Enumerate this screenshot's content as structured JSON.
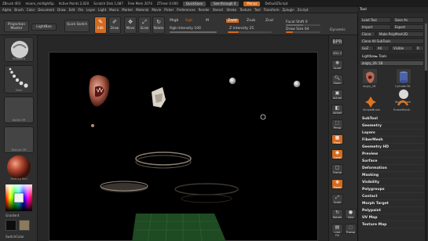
{
  "titlebar": {
    "app": "ZBrush 4R3",
    "file": "moore_midlightSp",
    "active_points": "Active Points 2,020",
    "scratch_disk": "Scratch Disk 1,687",
    "free_mem": "Free Mem 2074",
    "ztimer": "ZTimer 0.000",
    "quicksave": "QuickSave",
    "seethrough": "See-through 0",
    "menus_btn": "Menus",
    "default_script": "DefaultZScript"
  },
  "menubar": [
    "Alpha",
    "Brush",
    "Color",
    "Document",
    "Draw",
    "Edit",
    "File",
    "Layer",
    "Light",
    "Macro",
    "Marker",
    "Material",
    "Movie",
    "Picker",
    "Preferences",
    "Render",
    "Stencil",
    "Stroke",
    "Texture",
    "Tool",
    "Transform",
    "Zplugin",
    "Zscript"
  ],
  "toolbar": {
    "projection_master": "Projection Master",
    "lightbox": "LightBox",
    "quick_sketch": "Quick Sketch",
    "edit": "Edit",
    "draw": "Draw",
    "move": "Move",
    "scale": "Scale",
    "rotate": "Rotate",
    "mrgb": "Mrgb",
    "rgb": "Rgb",
    "m": "M",
    "rgb_intensity": "Rgb Intensity 100",
    "zadd": "Zadd",
    "zsub": "Zsub",
    "zcut": "Zcut",
    "z_intensity": "Z Intensity 25",
    "focal_shift": "Focal Shift 0",
    "draw_size": "Draw Size 64",
    "dynamic": "Dynamic"
  },
  "leftpanel": {
    "brush_label": "Standard",
    "stroke_label": "Dots",
    "alpha_label": "Alpha Off",
    "texture_label": "Texture Off",
    "material_label": "MatCap Red",
    "gradient_label": "Gradient",
    "switch_color_label": "SwitchColor"
  },
  "rightshelf": [
    "BPR",
    "SPix 3",
    "Scroll",
    "Zoom",
    "Actual",
    "AAHalf",
    "Persp",
    "Floor",
    "Local",
    "Frame",
    "Move",
    "Scale",
    "Rotate",
    "Line Fill",
    "Transp",
    "Solo"
  ],
  "tray": {
    "title": "Tool",
    "load_tool": "Load Tool",
    "save_as": "Save As",
    "import": "Import",
    "export": "Export",
    "clone": "Clone",
    "make_polymesh": "Make PolyMesh3D",
    "goz": "GoZ",
    "all": "All",
    "visible": "Visible",
    "r": "R",
    "clone_all_subtools": "Clone All SubTools",
    "lightbox_tools": "Lightbox► Tools",
    "current_tool": "angry_26. 58",
    "tool_names": [
      "angry_26",
      "Cylinder3D",
      "AlphaBrush",
      "SimpleBrush",
      "EraserBrush"
    ],
    "menu": [
      "SubTool",
      "Geometry",
      "Layers",
      "FiberMesh",
      "Geometry HD",
      "Preview",
      "Surface",
      "Deformation",
      "Masking",
      "Visibility",
      "Polygroups",
      "Contact",
      "Morph Target",
      "Polypaint",
      "UV Map",
      "Texture Map"
    ]
  }
}
